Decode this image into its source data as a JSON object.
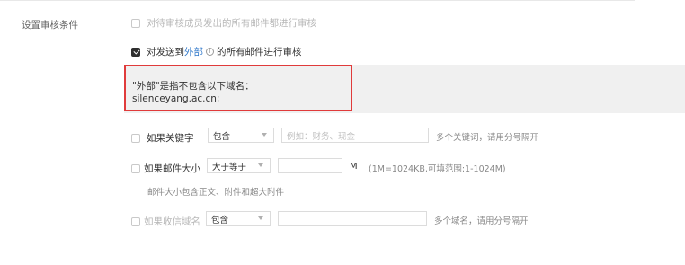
{
  "section_label": "设置审核条件",
  "options": {
    "internal_members": {
      "label": "对待审核成员发出的所有邮件都进行审核",
      "checked": false
    },
    "external": {
      "prefix": "对发送到",
      "link": "外部",
      "info_glyph": "i",
      "suffix": "的所有邮件进行审核",
      "checked": true
    }
  },
  "external_note": {
    "line1": "\"外部\"是指不包含以下域名：",
    "line2": "silenceyang.ac.cn;"
  },
  "keyword_rule": {
    "label": "如果关键字",
    "select": "包含",
    "placeholder": "例如：财务、现金",
    "hint": "多个关键词，请用分号隔开",
    "checked": false
  },
  "size_rule": {
    "label": "如果邮件大小",
    "select": "大于等于",
    "value": "",
    "unit": "M",
    "range_hint": "(1M=1024KB,可填范围:1-1024M)",
    "sub_hint": "邮件大小包含正文、附件和超大附件",
    "checked": false
  },
  "domain_rule": {
    "label": "如果收信域名",
    "select": "包含",
    "value": "",
    "hint": "多个域名，请用分号隔开",
    "checked": false
  },
  "colors": {
    "link": "#2d76c9",
    "highlight_border": "#e03b3b",
    "panel_bg": "#f0f0f0"
  }
}
